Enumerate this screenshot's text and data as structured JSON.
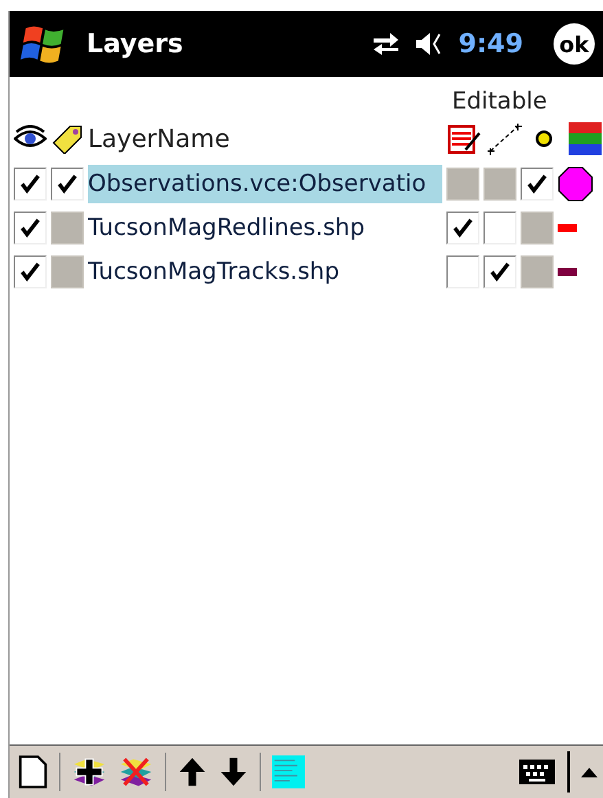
{
  "title_bar": {
    "title": "Layers",
    "time": "9:49",
    "ok": "ok"
  },
  "table": {
    "group_heading": "Editable",
    "name_heading": "LayerName",
    "rows": [
      {
        "name": "Observations.vce:Observatio",
        "selected": true,
        "visible": {
          "checked": true,
          "disabled": false
        },
        "labels": {
          "checked": true,
          "disabled": false
        },
        "editable": [
          {
            "checked": false,
            "disabled": true
          },
          {
            "checked": false,
            "disabled": true
          },
          {
            "checked": true,
            "disabled": false
          }
        ],
        "symbol": {
          "kind": "point",
          "color": "#ff00ff"
        }
      },
      {
        "name": "TucsonMagRedlines.shp",
        "selected": false,
        "visible": {
          "checked": true,
          "disabled": false
        },
        "labels": {
          "checked": false,
          "disabled": true
        },
        "editable": [
          {
            "checked": true,
            "disabled": false
          },
          {
            "checked": false,
            "disabled": false
          },
          {
            "checked": false,
            "disabled": true
          }
        ],
        "symbol": {
          "kind": "line",
          "color": "#ff0000"
        }
      },
      {
        "name": "TucsonMagTracks.shp",
        "selected": false,
        "visible": {
          "checked": true,
          "disabled": false
        },
        "labels": {
          "checked": false,
          "disabled": true
        },
        "editable": [
          {
            "checked": false,
            "disabled": false
          },
          {
            "checked": true,
            "disabled": false
          },
          {
            "checked": false,
            "disabled": true
          }
        ],
        "symbol": {
          "kind": "line",
          "color": "#800040"
        }
      }
    ]
  }
}
